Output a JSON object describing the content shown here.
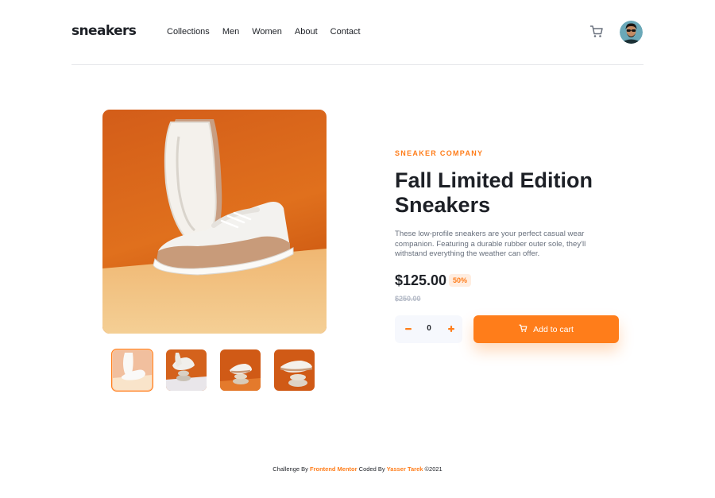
{
  "header": {
    "logo": "sneakers",
    "nav": [
      "Collections",
      "Men",
      "Women",
      "About",
      "Contact"
    ],
    "cart_icon": "cart-icon",
    "avatar": "user-avatar"
  },
  "gallery": {
    "main_image": "product-image-1",
    "thumbnails": [
      "thumbnail-1",
      "thumbnail-2",
      "thumbnail-3",
      "thumbnail-4"
    ],
    "active_thumbnail": 0
  },
  "product": {
    "company": "SNEAKER COMPANY",
    "title": "Fall Limited Edition Sneakers",
    "description": "These low-profile sneakers are your perfect casual wear companion. Featuring a durable rubber outer sole, they'll withstand everything the weather can offer.",
    "price": "$125.00",
    "discount": "50%",
    "old_price": "$250.00"
  },
  "cart": {
    "quantity": "0",
    "minus_icon": "minus-icon",
    "plus_icon": "plus-icon",
    "add_label": "Add to cart"
  },
  "footer": {
    "prefix": "Challenge By",
    "challenge_by": "Frontend Mentor",
    "middle": "Coded By",
    "coded_by": "Yasser Tarek",
    "suffix": "©2021"
  },
  "colors": {
    "accent": "#ff7d1a",
    "accent_light": "#ffede0",
    "dark": "#1d2026",
    "text_gray": "#68707d",
    "muted": "#b6bcc8",
    "qty_bg": "#f6f8fd"
  }
}
